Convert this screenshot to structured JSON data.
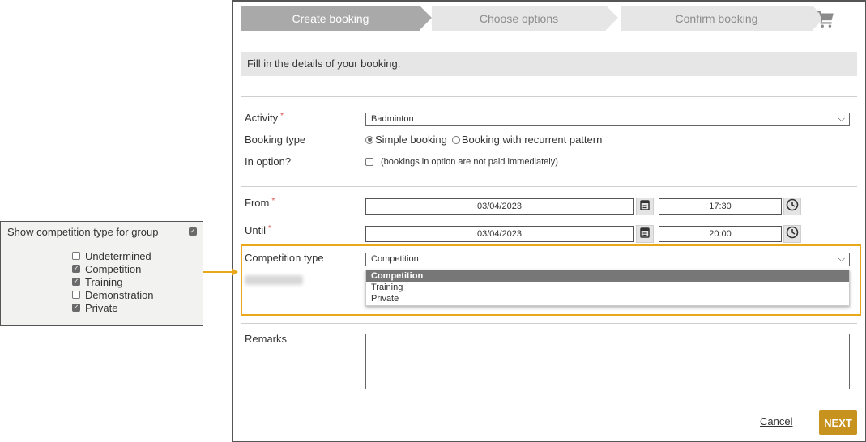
{
  "settings_panel": {
    "title": "Show competition type for group",
    "enabled": true,
    "options": [
      {
        "label": "Undetermined",
        "checked": false
      },
      {
        "label": "Competition",
        "checked": true
      },
      {
        "label": "Training",
        "checked": true
      },
      {
        "label": "Demonstration",
        "checked": false
      },
      {
        "label": "Private",
        "checked": true
      }
    ]
  },
  "stepper": {
    "steps": [
      {
        "label": "Create booking",
        "active": true
      },
      {
        "label": "Choose options",
        "active": false
      },
      {
        "label": "Confirm booking",
        "active": false
      }
    ],
    "cart_icon": "shopping-cart-icon"
  },
  "info_text": "Fill in the details of your booking.",
  "form": {
    "activity": {
      "label": "Activity",
      "required_mark": "*",
      "value": "Badminton"
    },
    "booking_type": {
      "label": "Booking type",
      "options": [
        {
          "label": "Simple booking",
          "selected": true
        },
        {
          "label": "Booking with recurrent pattern",
          "selected": false
        }
      ]
    },
    "in_option": {
      "label": "In option?",
      "checked": false,
      "hint": "(bookings in option are not paid immediately)"
    },
    "from": {
      "label": "From",
      "required_mark": "*",
      "date": "03/04/2023",
      "time": "17:30"
    },
    "until": {
      "label": "Until",
      "required_mark": "*",
      "date": "03/04/2023",
      "time": "20:00"
    },
    "competition_type": {
      "label": "Competition type",
      "value": "Competition",
      "dropdown_options": [
        {
          "label": "Competition",
          "highlighted": true
        },
        {
          "label": "Training",
          "highlighted": false
        },
        {
          "label": "Private",
          "highlighted": false
        }
      ]
    },
    "remarks": {
      "label": "Remarks",
      "value": ""
    }
  },
  "actions": {
    "cancel_label": "Cancel",
    "next_label": "NEXT"
  },
  "colors": {
    "accent": "#e8a81a",
    "next_button": "#c8921e",
    "active_step": "#a9a9a9",
    "inactive_step": "#e6e6e6",
    "required": "#d9534f"
  }
}
